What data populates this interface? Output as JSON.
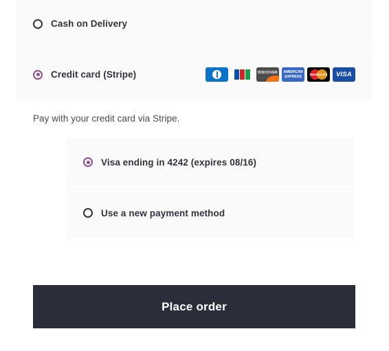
{
  "payment_methods": {
    "options": [
      {
        "id": "cod",
        "label": "Cash on Delivery",
        "selected": false
      },
      {
        "id": "stripe",
        "label": "Credit card (Stripe)",
        "selected": true
      }
    ],
    "card_brands": [
      {
        "name": "diners-club",
        "text": ""
      },
      {
        "name": "jcb",
        "text": "JCB"
      },
      {
        "name": "discover",
        "text": "DISCOVER"
      },
      {
        "name": "american-express",
        "line1": "AMERICAN",
        "line2": "EXPRESS"
      },
      {
        "name": "mastercard",
        "text": "MasterCard"
      },
      {
        "name": "visa",
        "text": "VISA"
      }
    ],
    "description": "Pay with your credit card via Stripe."
  },
  "saved_cards": {
    "items": [
      {
        "id": "saved-visa-4242",
        "label": "Visa ending in 4242 (expires 08/16)",
        "selected": true
      },
      {
        "id": "new-payment-method",
        "label": "Use a new payment method",
        "selected": false
      }
    ]
  },
  "actions": {
    "place_order_label": "Place order"
  },
  "colors": {
    "accent_radio": "#8c4f8f",
    "button_bg": "#2b2d3a",
    "panel_bg": "#fafafa",
    "text_primary": "#32323c",
    "text_secondary": "#4a4a52"
  }
}
